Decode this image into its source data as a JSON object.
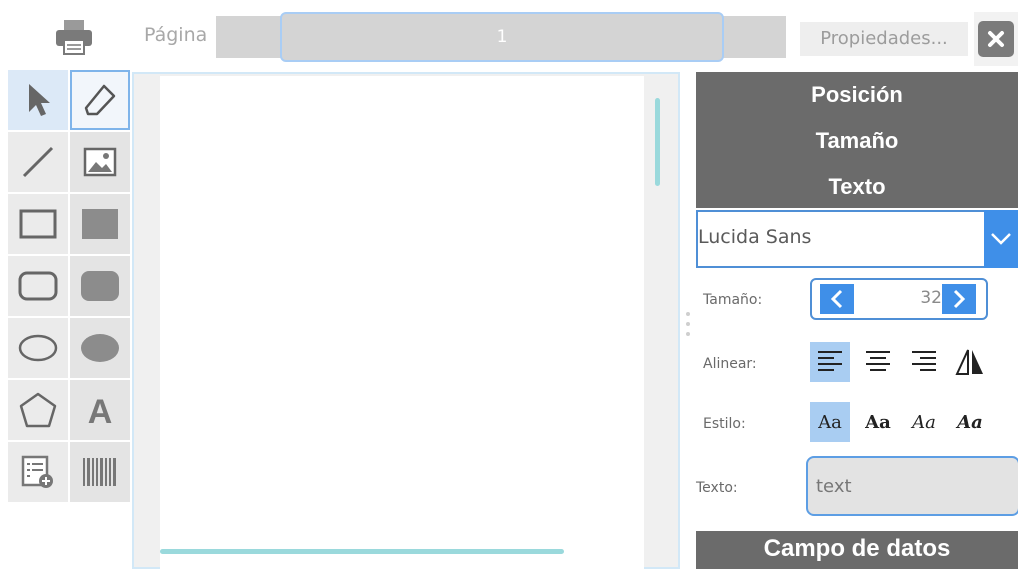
{
  "toolbar_top": {
    "page_label": "Página",
    "page_value": "1",
    "properties_label": "Propiedades...",
    "print_icon": "printer-icon",
    "close_icon": "close-icon"
  },
  "tools": [
    {
      "name": "select",
      "icon": "cursor-arrow-icon"
    },
    {
      "name": "eraser",
      "icon": "eraser-icon"
    },
    {
      "name": "line",
      "icon": "line-icon"
    },
    {
      "name": "image",
      "icon": "image-icon"
    },
    {
      "name": "rectangle",
      "icon": "rectangle-outline-icon"
    },
    {
      "name": "rectangle-filled",
      "icon": "rectangle-filled-icon"
    },
    {
      "name": "rounded-rectangle",
      "icon": "rounded-rectangle-outline-icon"
    },
    {
      "name": "rounded-rectangle-filled",
      "icon": "rounded-rectangle-filled-icon"
    },
    {
      "name": "ellipse",
      "icon": "ellipse-outline-icon"
    },
    {
      "name": "ellipse-filled",
      "icon": "ellipse-filled-icon"
    },
    {
      "name": "polygon",
      "icon": "pentagon-icon"
    },
    {
      "name": "text",
      "icon": "text-a-icon"
    },
    {
      "name": "data-field",
      "icon": "add-field-icon"
    },
    {
      "name": "barcode",
      "icon": "barcode-icon"
    }
  ],
  "panel": {
    "sections": [
      "Posición",
      "Tamaño",
      "Texto"
    ],
    "font": "Lucida Sans",
    "size_label": "Tamaño:",
    "size_value": "32",
    "align_label": "Alinear:",
    "align_options": [
      "align-left-icon",
      "align-center-icon",
      "align-right-icon",
      "mirror-icon"
    ],
    "style_label": "Estilo:",
    "style_options": [
      "Aa",
      "Aa",
      "Aa",
      "Aa"
    ],
    "text_label": "Texto:",
    "text_value": "text",
    "data_section": "Campo de datos"
  },
  "colors": {
    "accent": "#3f8fe8",
    "header_bg": "#6b6b6b",
    "scroll": "#9ad9dc"
  }
}
